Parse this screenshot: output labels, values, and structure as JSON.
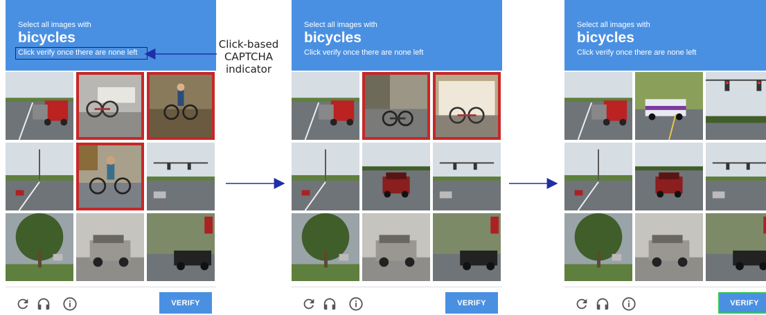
{
  "header": {
    "line1": "Select all images with",
    "target": "bicycles",
    "line3": "Click verify once there are none left"
  },
  "verify_label": "VERIFY",
  "annotation": {
    "line1": "Click-based",
    "line2": "CAPTCHA",
    "line3": "indicator"
  },
  "icons": [
    "reload-icon",
    "headphones-icon",
    "info-icon"
  ],
  "colors": {
    "header_blue": "#4a90e2",
    "selected_border": "#c62828",
    "verify_highlight": "#34c759",
    "arrow": "#1f2fa8"
  },
  "steps": [
    {
      "tiles": [
        "highway-truck",
        "bikes-at-rack",
        "cyclist-blurred",
        "highway-road",
        "cyclist-street",
        "road-intersection",
        "street-tree",
        "suv-parked",
        "road-sign-car"
      ],
      "selected": [
        false,
        true,
        true,
        false,
        true,
        false,
        false,
        false,
        false
      ],
      "verify_highlighted": false,
      "instruction_highlighted": true
    },
    {
      "tiles": [
        "highway-truck",
        "bike-sidewalk",
        "bikes-on-rv",
        "highway-road",
        "car-on-road",
        "road-intersection",
        "street-tree",
        "suv-parked",
        "road-sign-car"
      ],
      "selected": [
        false,
        true,
        true,
        false,
        false,
        false,
        false,
        false,
        false
      ],
      "verify_highlighted": false,
      "instruction_highlighted": false
    },
    {
      "tiles": [
        "highway-truck",
        "bus-on-road",
        "traffic-lights",
        "highway-road",
        "car-on-road",
        "road-intersection",
        "street-tree",
        "suv-parked",
        "road-sign-car"
      ],
      "selected": [
        false,
        false,
        false,
        false,
        false,
        false,
        false,
        false,
        false
      ],
      "verify_highlighted": true,
      "instruction_highlighted": false
    }
  ]
}
